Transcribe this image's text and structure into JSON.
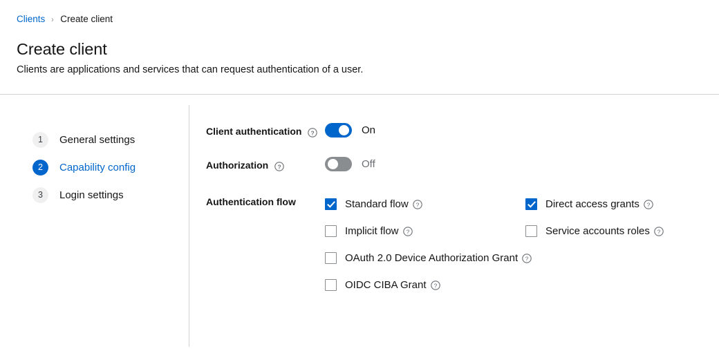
{
  "breadcrumb": {
    "link_label": "Clients",
    "separator": "›",
    "current_label": "Create client"
  },
  "header": {
    "title": "Create client",
    "subtitle": "Clients are applications and services that can request authentication of a user."
  },
  "wizard_nav": {
    "steps": [
      {
        "number": "1",
        "label": "General settings",
        "active": false
      },
      {
        "number": "2",
        "label": "Capability config",
        "active": true
      },
      {
        "number": "3",
        "label": "Login settings",
        "active": false
      }
    ]
  },
  "form": {
    "client_authentication": {
      "label": "Client authentication",
      "help_icon": "help-circle-icon",
      "state_label": "On",
      "enabled": true
    },
    "authorization": {
      "label": "Authorization",
      "help_icon": "help-circle-icon",
      "state_label": "Off",
      "enabled": false
    },
    "authentication_flow": {
      "label": "Authentication flow",
      "options": [
        {
          "label": "Standard flow",
          "checked": true,
          "help_icon": "help-circle-icon"
        },
        {
          "label": "Direct access grants",
          "checked": true,
          "help_icon": "help-circle-icon"
        },
        {
          "label": "Implicit flow",
          "checked": false,
          "help_icon": "help-circle-icon"
        },
        {
          "label": "Service accounts roles",
          "checked": false,
          "help_icon": "help-circle-icon"
        },
        {
          "label": "OAuth 2.0 Device Authorization Grant",
          "checked": false,
          "help_icon": "help-circle-icon"
        },
        {
          "label": "OIDC CIBA Grant",
          "checked": false,
          "help_icon": "help-circle-icon"
        }
      ]
    }
  },
  "colors": {
    "accent": "#0066cc",
    "toggle_off": "#8a8d90",
    "text": "#151515",
    "muted_text": "#6a6e73",
    "divider": "#d2d2d2"
  }
}
